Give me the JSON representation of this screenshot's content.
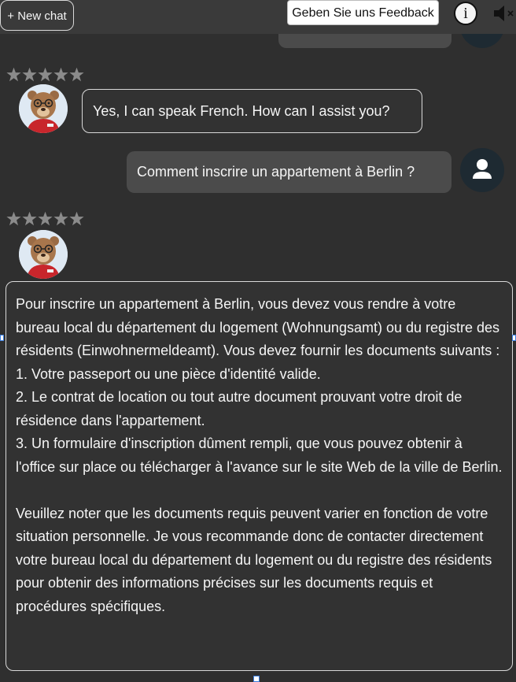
{
  "header": {
    "new_chat_label": "+ New chat",
    "feedback_label": "Geben Sie uns Feedback",
    "info_label": "i",
    "speaker_icon": "speaker-muted-icon"
  },
  "messages": [
    {
      "role": "user",
      "text": "",
      "partial": true
    },
    {
      "role": "assistant",
      "rating": 0,
      "text": "Yes, I can speak French. How can I assist you?"
    },
    {
      "role": "user",
      "text": "Comment inscrire un appartement à Berlin ?"
    },
    {
      "role": "assistant",
      "rating": 0,
      "text_p1": "Pour inscrire un appartement à Berlin, vous devez vous rendre à votre bureau local du département du logement (Wohnungsamt) ou du registre des résidents (Einwohnermeldeamt). Vous devez fournir les documents suivants :\n1. Votre passeport ou une pièce d'identité valide.\n2. Le contrat de location ou tout autre document prouvant votre droit de résidence dans l'appartement.\n3. Un formulaire d'inscription dûment rempli, que vous pouvez obtenir à l'office sur place ou télécharger à l'avance sur le site Web de la ville de Berlin.",
      "text_p2": "Veuillez noter que les documents requis peuvent varier en fonction de votre situation personnelle. Je vous recommande donc de contacter directement votre bureau local du département du logement ou du registre des résidents pour obtenir des informations précises sur les documents requis et procédures spécifiques."
    }
  ],
  "colors": {
    "background": "#2f2f2f",
    "user_bubble": "#4b4b4b",
    "bot_bubble_border": "#d9d9d9",
    "user_avatar_bg": "#1e2a32",
    "star_inactive": "#8b8b8b"
  }
}
